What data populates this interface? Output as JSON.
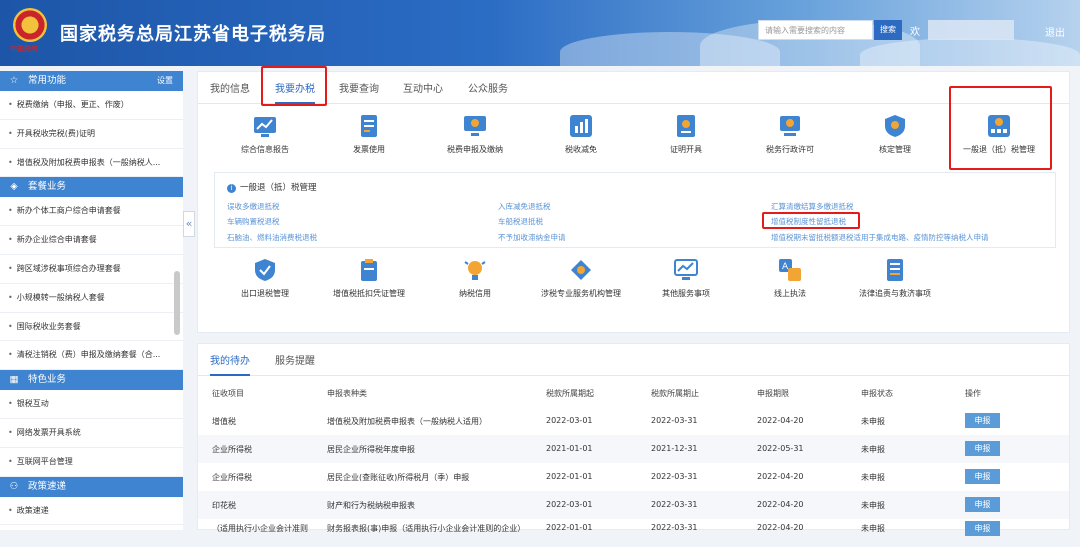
{
  "header": {
    "emblem_text": "中国税务",
    "title": "国家税务总局江苏省电子税务局",
    "search_placeholder": "请输入需要搜索的内容",
    "search_button": "搜索",
    "welcome": "欢",
    "logout": "退出"
  },
  "sidebar": {
    "sections": [
      {
        "title": "常用功能",
        "icon": "star-icon",
        "action": "设置",
        "items": [
          "税费缴纳（申报、更正、作废）",
          "开具税收完税(费)证明",
          "增值税及附加税费申报表（一般纳税人..."
        ]
      },
      {
        "title": "套餐业务",
        "icon": "stack-icon",
        "items": [
          "新办个体工商户综合申请套餐",
          "新办企业综合申请套餐",
          "跨区域涉税事项综合办理套餐",
          "小规模转一般纳税人套餐",
          "国际税收业务套餐",
          "清税注销税（费）申报及缴纳套餐（合..."
        ]
      },
      {
        "title": "特色业务",
        "icon": "grid-icon",
        "items": [
          "银税互动",
          "网络发票开具系统",
          "互联网平台管理"
        ]
      },
      {
        "title": "政策速递",
        "icon": "user-icon",
        "items": [
          "政策速递"
        ]
      }
    ]
  },
  "main_tabs": [
    "我的信息",
    "我要办税",
    "我要查询",
    "互动中心",
    "公众服务"
  ],
  "service_row1": [
    "综合信息报告",
    "发票使用",
    "税费申报及缴纳",
    "税收减免",
    "证明开具",
    "税务行政许可",
    "核定管理",
    "一般退（抵）税管理"
  ],
  "subpanel": {
    "title": "一般退（抵）税管理",
    "links_col1": [
      "误收多缴退抵税",
      "车辆购置税退税",
      "石脑油、燃料油消费税退税"
    ],
    "links_col2": [
      "入库减免退抵税",
      "车船税退抵税",
      "不予加收滞纳金申请"
    ],
    "links_col3": [
      "汇算清缴结算多缴退抵税",
      "增值税制度性留抵退税",
      "增值税期末留抵税额退税适用于集成电路、疫情防控等纳税人申请"
    ]
  },
  "service_row2": [
    "出口退税管理",
    "增值税抵扣凭证管理",
    "纳税信用",
    "涉税专业服务机构管理",
    "其他服务事项",
    "线上执法",
    "法律追责与救济事项"
  ],
  "todo": {
    "tabs": [
      "我的待办",
      "服务提醒"
    ],
    "columns": [
      "征收项目",
      "申报表种类",
      "税款所属期起",
      "税款所属期止",
      "申报期限",
      "申报状态",
      "操作"
    ],
    "rows": [
      [
        "增值税",
        "增值税及附加税费申报表（一般纳税人适用）",
        "2022-03-01",
        "2022-03-31",
        "2022-04-20",
        "未申报",
        "申报"
      ],
      [
        "企业所得税",
        "居民企业所得税年度申报",
        "2021-01-01",
        "2021-12-31",
        "2022-05-31",
        "未申报",
        "申报"
      ],
      [
        "企业所得税",
        "居民企业(查账征收)所得税月（季）申报",
        "2022-01-01",
        "2022-03-31",
        "2022-04-20",
        "未申报",
        "申报"
      ],
      [
        "印花税",
        "财产和行为税纳税申报表",
        "2022-03-01",
        "2022-03-31",
        "2022-04-20",
        "未申报",
        "申报"
      ],
      [
        "（适用执行小企业会计准则",
        "财务报表报(事)申报（适用执行小企业会计准则的企业）",
        "2022-01-01",
        "2022-03-31",
        "2022-04-20",
        "未申报",
        "申报"
      ]
    ]
  },
  "colors": {
    "accent": "#2d6bc3",
    "section_bar": "#3f84d0",
    "highlight": "#e31b1b",
    "link": "#5a93d6"
  }
}
